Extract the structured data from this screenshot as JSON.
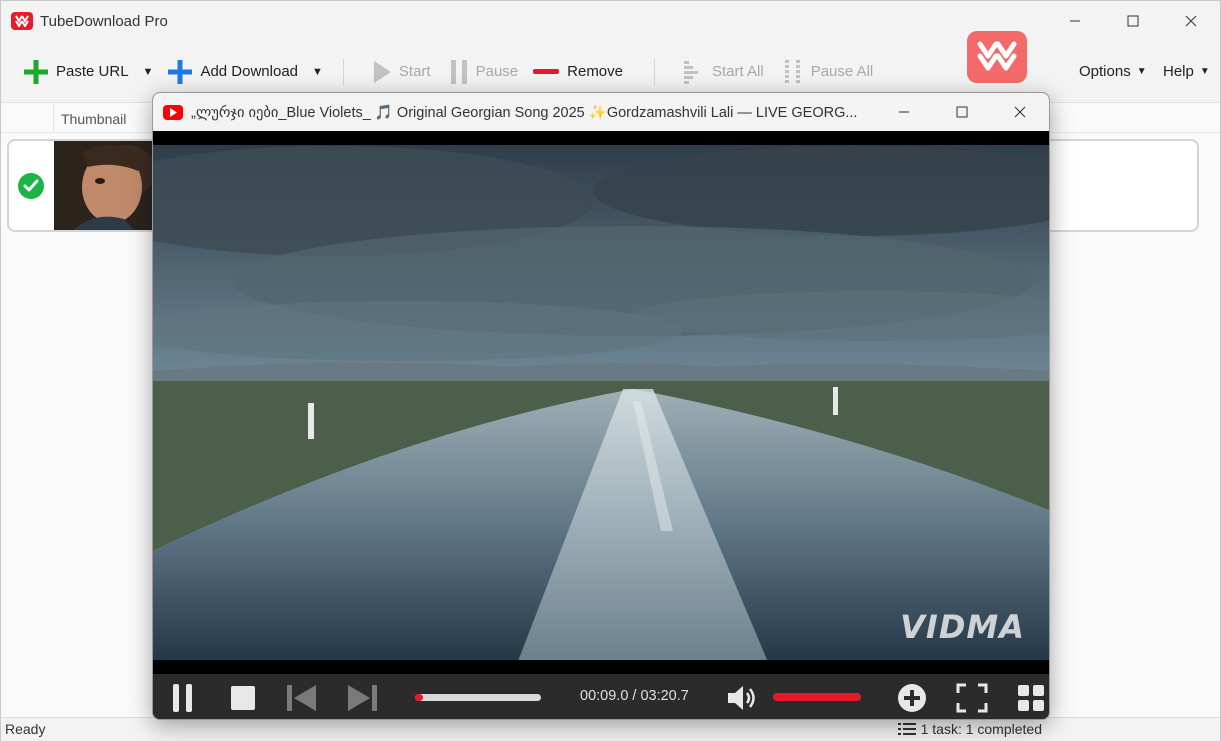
{
  "app": {
    "title": "TubeDownload Pro"
  },
  "toolbar": {
    "paste_url": "Paste URL",
    "add_download": "Add Download",
    "start": "Start",
    "pause": "Pause",
    "remove": "Remove",
    "start_all": "Start All",
    "pause_all": "Pause All",
    "options": "Options",
    "help": "Help"
  },
  "list": {
    "columns": [
      "Thumbnail"
    ],
    "rows": [
      {
        "status": "completed",
        "thumbnail": "man-portrait"
      }
    ]
  },
  "status": {
    "left": "Ready",
    "right": "1 task: 1 completed"
  },
  "player": {
    "title": "„ლურჯი იები_Blue Violets_ 🎵 Original Georgian Song 2025 ✨Gordzamashvili Lali — LIVE GEORG...",
    "time": "00:09.0 / 03:20.7",
    "watermark": "VIDMA",
    "progress": 0.045,
    "volume": 1.0
  },
  "colors": {
    "accent": "#e8182b",
    "brand": "#e81c2b",
    "success": "#1db447",
    "add": "#1aa928",
    "add_download": "#1e7be6"
  }
}
